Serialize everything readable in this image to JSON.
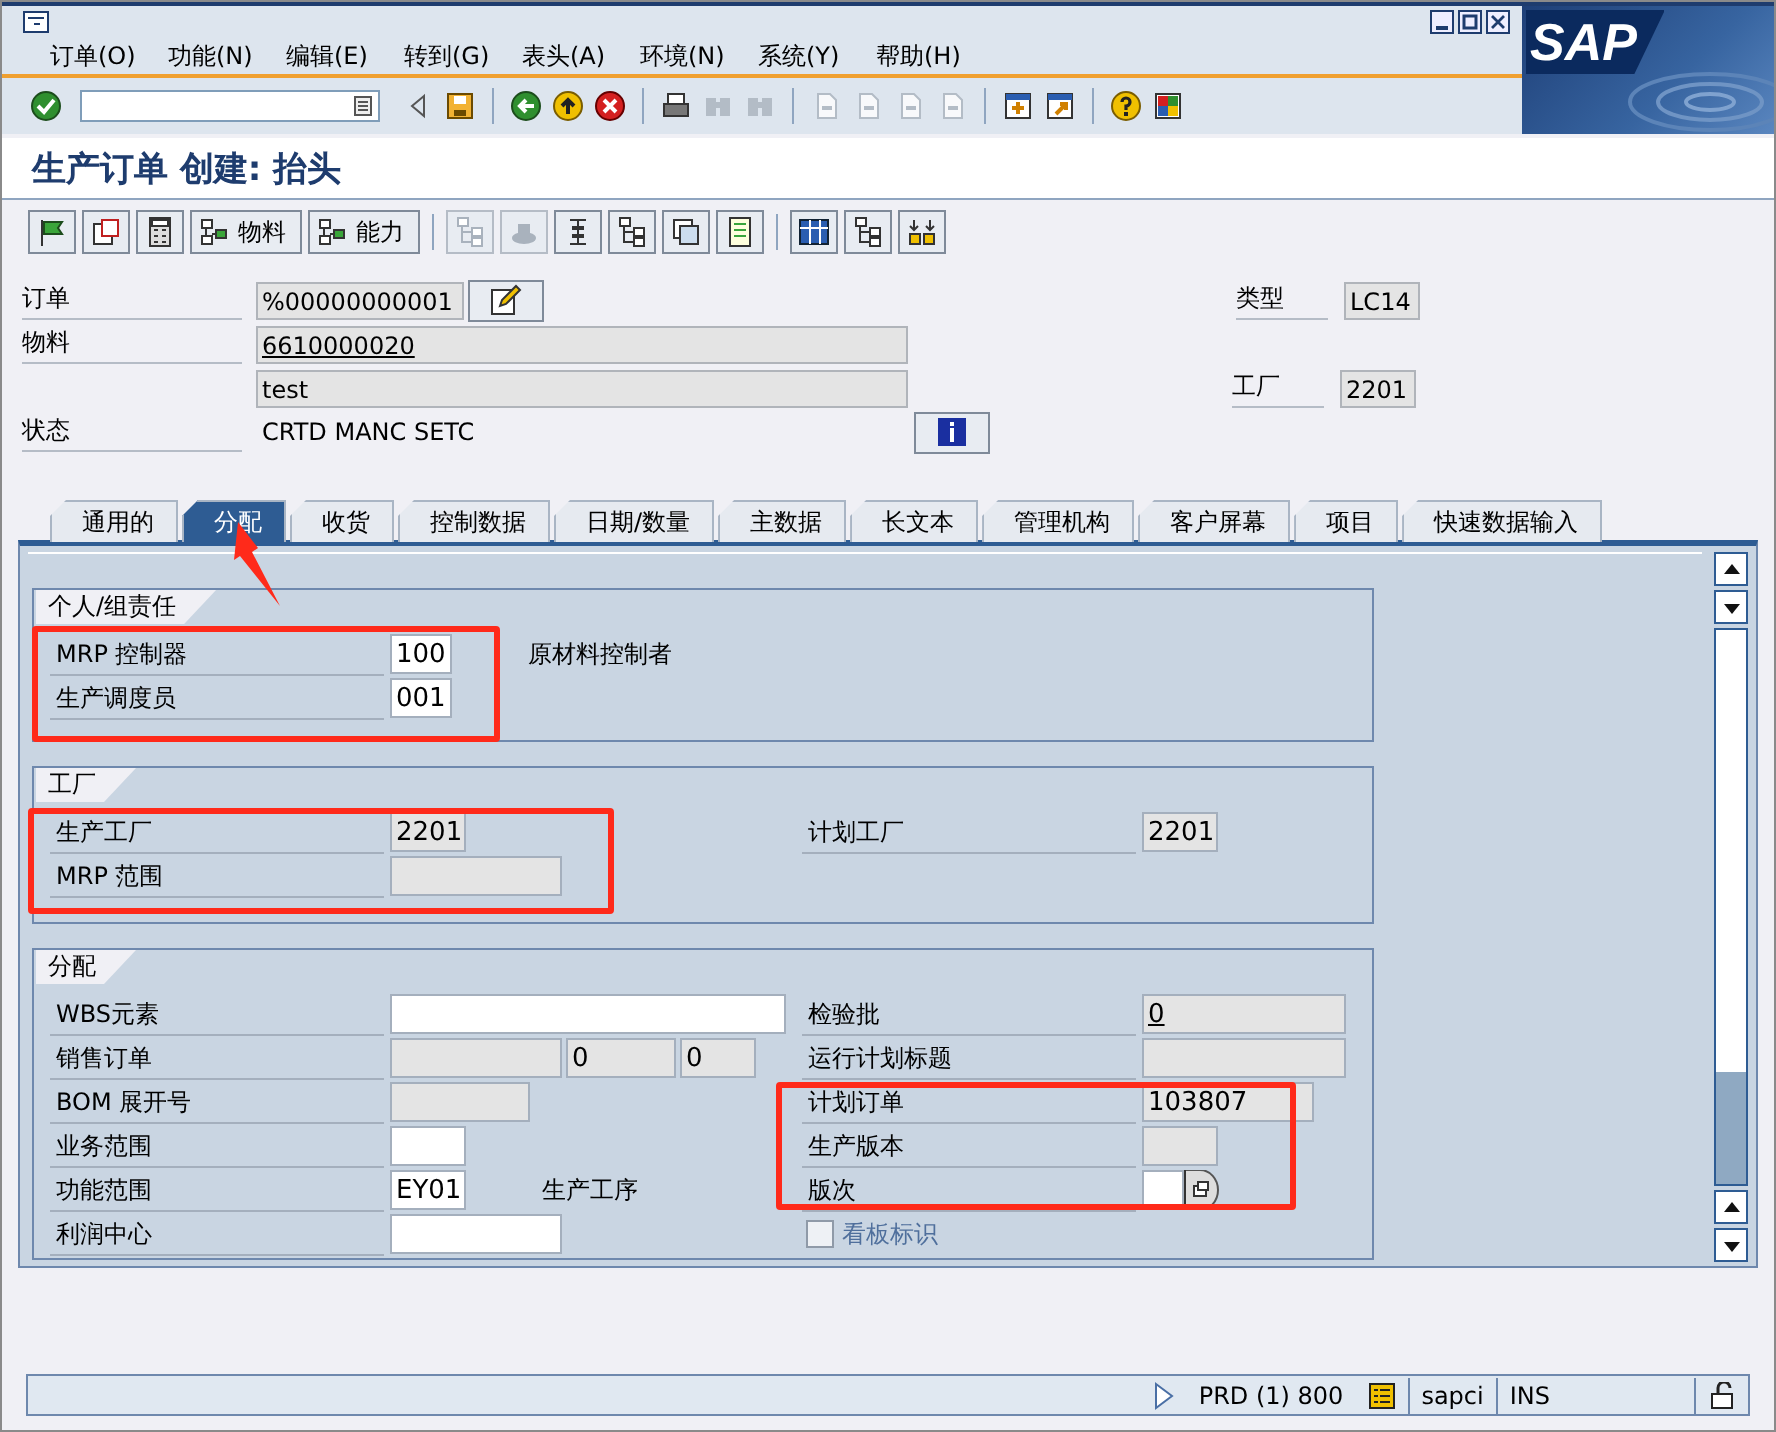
{
  "window": {
    "logo": "SAP"
  },
  "menu": [
    {
      "label": "订单(O)"
    },
    {
      "label": "功能(N)"
    },
    {
      "label": "编辑(E)"
    },
    {
      "label": "转到(G)"
    },
    {
      "label": "表头(A)"
    },
    {
      "label": "环境(N)"
    },
    {
      "label": "系统(Y)"
    },
    {
      "label": "帮助(H)"
    }
  ],
  "toolbar": [
    {
      "disabled": false
    },
    {
      "disabled": false
    },
    {
      "disabled": false
    },
    {
      "disabled": false
    },
    {
      "disabled": false
    },
    {
      "disabled": false
    },
    {
      "disabled": false
    },
    {
      "disabled": true
    },
    {
      "disabled": true
    },
    {
      "disabled": true
    },
    {
      "disabled": true
    },
    {
      "disabled": true
    },
    {
      "disabled": true
    },
    {
      "disabled": false
    },
    {
      "disabled": false
    },
    {
      "disabled": false
    },
    {
      "disabled": false
    }
  ],
  "title": "生产订单 创建: 抬头",
  "app_toolbar": [
    {
      "disabled": false
    },
    {
      "disabled": false
    },
    {
      "disabled": false
    },
    {
      "label": "物料",
      "disabled": false
    },
    {
      "label": "能力",
      "disabled": false
    },
    {
      "disabled": true
    },
    {
      "disabled": true
    },
    {
      "disabled": false
    },
    {
      "disabled": false
    },
    {
      "disabled": false
    },
    {
      "disabled": false
    },
    {
      "disabled": false
    },
    {
      "disabled": false
    },
    {
      "disabled": false
    }
  ],
  "header": {
    "order": {
      "label": "订单",
      "value": "%00000000001"
    },
    "material": {
      "label": "物料",
      "value": "6610000020",
      "description": "test"
    },
    "status": {
      "label": "状态",
      "value": "CRTD MANC SETC"
    },
    "type": {
      "label": "类型",
      "value": "LC14"
    },
    "plant": {
      "label": "工厂",
      "value": "2201"
    }
  },
  "tabs": [
    {
      "label": "通用的",
      "selected": false
    },
    {
      "label": "分配",
      "selected": true
    },
    {
      "label": "收货",
      "selected": false
    },
    {
      "label": "控制数据",
      "selected": false
    },
    {
      "label": "日期/数量",
      "selected": false
    },
    {
      "label": "主数据",
      "selected": false
    },
    {
      "label": "长文本",
      "selected": false
    },
    {
      "label": "管理机构",
      "selected": false
    },
    {
      "label": "客户屏幕",
      "selected": false
    },
    {
      "label": "项目",
      "selected": false
    },
    {
      "label": "快速数据输入",
      "selected": false
    }
  ],
  "sections": [
    {
      "title": "个人/组责任",
      "left": [
        {
          "label": "MRP 控制器",
          "value": "100",
          "editable": true,
          "note": "原材料控制者"
        },
        {
          "label": "生产调度员",
          "value": "001",
          "editable": true
        }
      ]
    },
    {
      "title": "工厂",
      "left": [
        {
          "label": "生产工厂",
          "value": "2201",
          "editable": false
        },
        {
          "label": "MRP 范围",
          "editable": false
        }
      ],
      "right": [
        {
          "label": "计划工厂",
          "value": "2201",
          "editable": false
        }
      ]
    },
    {
      "title": "分配",
      "left": [
        {
          "label": "WBS元素",
          "editable": true
        },
        {
          "label": "销售订单",
          "editable": false,
          "extra": [
            "0",
            "0"
          ]
        },
        {
          "label": "BOM 展开号",
          "editable": false
        },
        {
          "label": "业务范围",
          "editable": true
        },
        {
          "label": "功能范围",
          "value": "EY01",
          "editable": true,
          "note": "生产工序"
        },
        {
          "label": "利润中心",
          "editable": true
        }
      ],
      "right": [
        {
          "label": "检验批",
          "value": "0",
          "editable": false,
          "underlined": true
        },
        {
          "label": "运行计划标题",
          "editable": false
        },
        {
          "label": "计划订单",
          "value": "103807",
          "editable": false
        },
        {
          "label": "生产版本",
          "editable": false
        },
        {
          "label": "版次",
          "editable": true,
          "help": true
        },
        {
          "kind": "checkbox",
          "label": "看板标识",
          "checked": false,
          "disabled": true
        }
      ]
    }
  ],
  "status_bar": {
    "system": "PRD (1) 800",
    "server": "sapci",
    "mode": "INS"
  }
}
